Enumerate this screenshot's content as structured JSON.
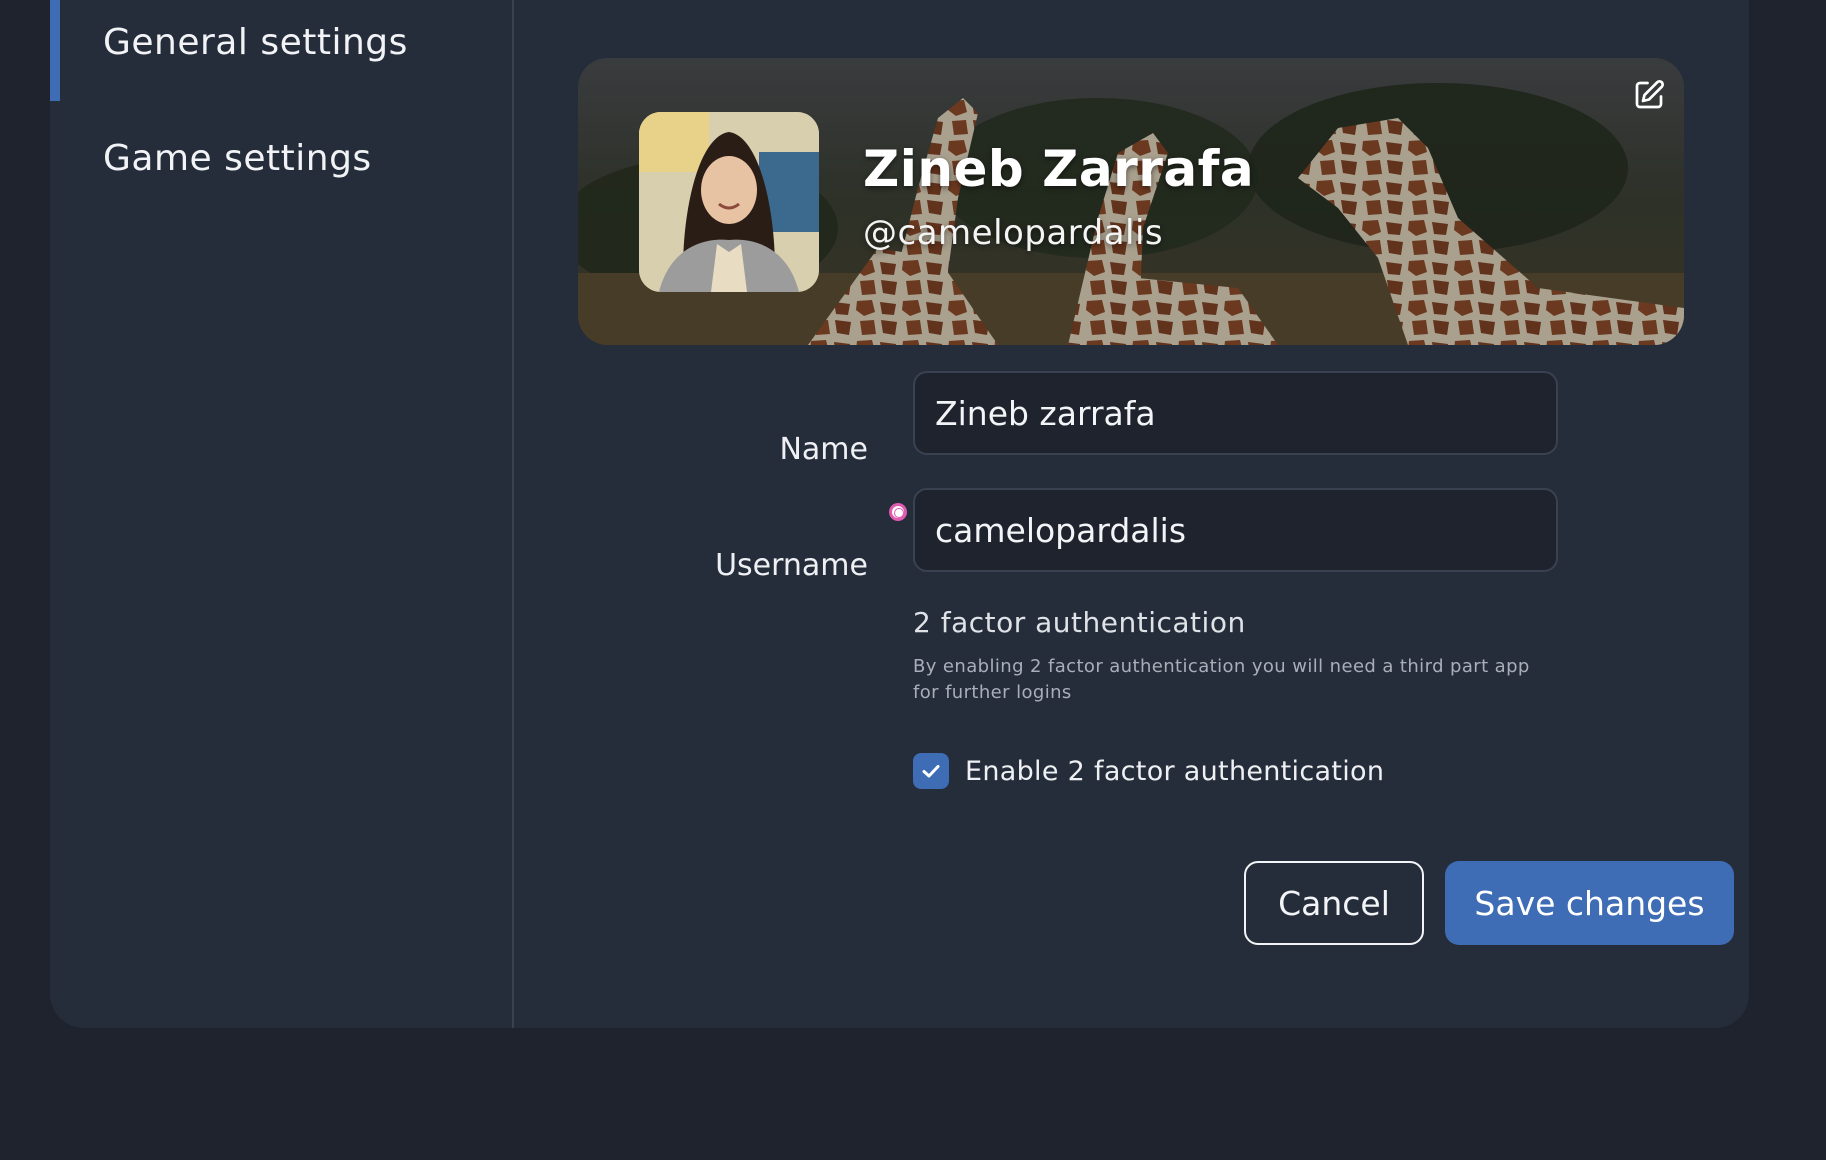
{
  "sidebar": {
    "items": [
      {
        "label": "General settings",
        "active": true
      },
      {
        "label": "Game settings",
        "active": false
      }
    ]
  },
  "profile": {
    "display_name": "Zineb Zarrafa",
    "handle": "@camelopardalis",
    "edit_icon": "edit-icon"
  },
  "form": {
    "name_label": "Name",
    "name_value": "Zineb zarrafa",
    "username_label": "Username",
    "username_value": "camelopardalis"
  },
  "two_factor": {
    "title": "2 factor authentication",
    "description": "By enabling 2 factor authentication you will need a third part app for further logins",
    "checkbox_label": "Enable 2 factor authentication",
    "checked": true
  },
  "actions": {
    "cancel_label": "Cancel",
    "save_label": "Save changes"
  },
  "colors": {
    "accent": "#3e6db5",
    "background": "#1f232d",
    "panel": "#262d3a"
  }
}
